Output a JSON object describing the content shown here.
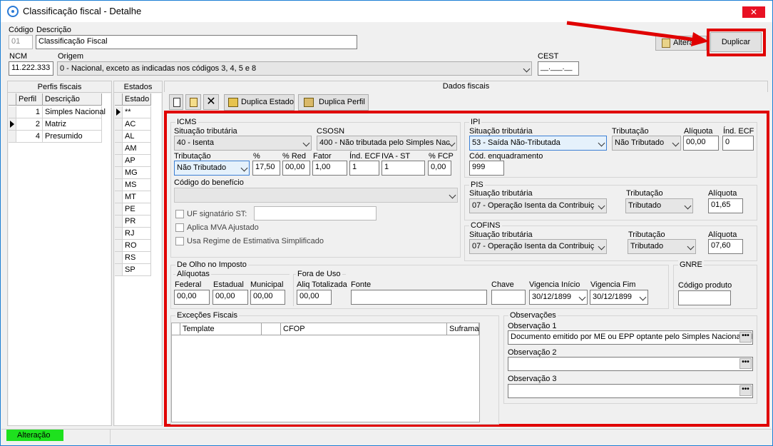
{
  "window": {
    "title": "Classificação fiscal - Detalhe",
    "close": "✕"
  },
  "header": {
    "codigo_label": "Código",
    "codigo_value": "01",
    "descricao_label": "Descrição",
    "descricao_value": "Classificação Fiscal",
    "alterar_label": "Alterar",
    "duplicar_label": "Duplicar",
    "ncm_label": "NCM",
    "ncm_value": "11.222.333",
    "origem_label": "Origem",
    "origem_value": "0 - Nacional, exceto as indicadas nos códigos 3, 4, 5 e 8",
    "cest_label": "CEST",
    "cest_value": "__.___.__"
  },
  "perfis": {
    "title": "Perfis fiscais",
    "col_perfil": "Perfil",
    "col_desc": "Descrição",
    "rows": [
      {
        "perfil": "1",
        "desc": "Simples Nacional"
      },
      {
        "perfil": "2",
        "desc": "Matriz"
      },
      {
        "perfil": "4",
        "desc": "Presumido"
      }
    ]
  },
  "estados": {
    "title": "Estados",
    "col": "Estado",
    "items": [
      "**",
      "AC",
      "AL",
      "AM",
      "AP",
      "MG",
      "MS",
      "MT",
      "PE",
      "PR",
      "RJ",
      "RO",
      "RS",
      "SP"
    ]
  },
  "dados": {
    "title": "Dados fiscais",
    "duplica_estado": "Duplica Estado",
    "duplica_perfil": "Duplica Perfil"
  },
  "icms": {
    "title": "ICMS",
    "sit_label": "Situação tributária",
    "sit_value": "40 - Isenta",
    "csosn_label": "CSOSN",
    "csosn_value": "400 - Não tributada pelo Simples Nac",
    "trib_label": "Tributação",
    "trib_value": "Não Tributado",
    "pct_label": "%",
    "pct_value": "17,50",
    "pctred_label": "% Red",
    "pctred_value": "00,00",
    "fator_label": "Fator",
    "fator_value": "1,00",
    "indecf_label": "Índ. ECF",
    "indecf_value": "1",
    "ivast_label": "IVA - ST",
    "ivast_value": "1",
    "fcp_label": "% FCP",
    "fcp_value": "0,00",
    "codben_label": "Código do benefício",
    "uf_label": "UF signatário ST:",
    "mva_label": "Aplica MVA Ajustado",
    "regime_label": "Usa Regime de Estimativa Simplificado"
  },
  "ipi": {
    "title": "IPI",
    "sit_label": "Situação tributária",
    "sit_value": "53 - Saída Não-Tributada",
    "trib_label": "Tributação",
    "trib_value": "Não Tributado",
    "aliq_label": "Alíquota",
    "aliq_value": "00,00",
    "indecf_label": "Índ. ECF",
    "indecf_value": "0",
    "enq_label": "Cód. enquadramento",
    "enq_value": "999"
  },
  "pis": {
    "title": "PIS",
    "sit_label": "Situação tributária",
    "sit_value": "07 - Operação Isenta da Contribuiç",
    "trib_label": "Tributação",
    "trib_value": "Tributado",
    "aliq_label": "Alíquota",
    "aliq_value": "01,65"
  },
  "cofins": {
    "title": "COFINS",
    "sit_label": "Situação tributária",
    "sit_value": "07 - Operação Isenta da Contribuiç",
    "trib_label": "Tributação",
    "trib_value": "Tributado",
    "aliq_label": "Alíquota",
    "aliq_value": "07,60"
  },
  "olho": {
    "title": "De Olho no Imposto",
    "aliquotas_title": "Alíquotas",
    "federal_label": "Federal",
    "federal_value": "00,00",
    "estadual_label": "Estadual",
    "estadual_value": "00,00",
    "municipal_label": "Municipal",
    "municipal_value": "00,00",
    "fora_title": "Fora de Uso",
    "aliqtot_label": "Aliq Totalizada",
    "aliqtot_value": "00,00",
    "fonte_label": "Fonte",
    "chave_label": "Chave",
    "vigini_label": "Vigencia Início",
    "vigini_value": "30/12/1899",
    "vigfim_label": "Vigencia Fim",
    "vigfim_value": "30/12/1899"
  },
  "gnre": {
    "title": "GNRE",
    "cod_label": "Código produto"
  },
  "excecoes": {
    "title": "Exceções Fiscais",
    "col_template": "Template",
    "col_cfop": "CFOP",
    "col_suframa": "Suframa"
  },
  "obs": {
    "title": "Observações",
    "obs1_label": "Observação 1",
    "obs1_value": "Documento emitido por ME ou EPP optante pelo Simples Nacional; N",
    "obs2_label": "Observação 2",
    "obs3_label": "Observação 3",
    "dots": "•••"
  },
  "status": {
    "mode": "Alteração"
  },
  "colors": {
    "highlight": "#e00000",
    "status_green": "#1ee11e"
  }
}
